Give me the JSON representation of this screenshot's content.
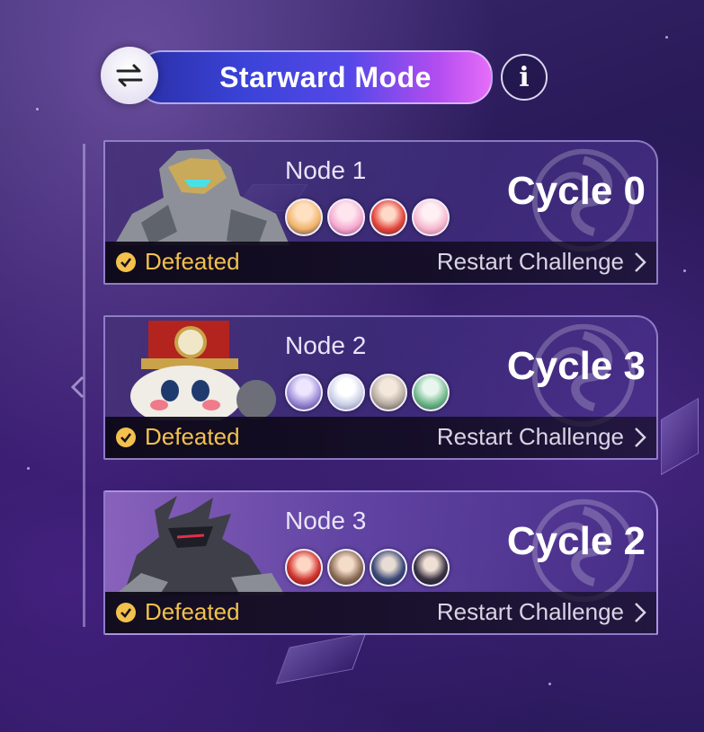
{
  "header": {
    "mode_label": "Starward Mode",
    "info_glyph": "i",
    "switch_icon": "swap-arrows-icon"
  },
  "nodes": [
    {
      "title": "Node 1",
      "cycle": "Cycle 0",
      "status": "Defeated",
      "action": "Restart Challenge",
      "avatar_colors": [
        "#f0b46a",
        "#f5a9d0",
        "#e2483e",
        "#f6b8cf"
      ]
    },
    {
      "title": "Node 2",
      "cycle": "Cycle 3",
      "status": "Defeated",
      "action": "Restart Challenge",
      "avatar_colors": [
        "#9c8ad6",
        "#c9cfe6",
        "#b7aca2",
        "#6fb88a"
      ]
    },
    {
      "title": "Node 3",
      "cycle": "Cycle 2",
      "status": "Defeated",
      "action": "Restart Challenge",
      "avatar_colors": [
        "#d0352f",
        "#8a6a54",
        "#3c4a78",
        "#3a3344"
      ]
    }
  ],
  "colors": {
    "status_gold": "#f3c14c",
    "accent_pink": "#e76df8",
    "accent_blue": "#3a43d8"
  }
}
